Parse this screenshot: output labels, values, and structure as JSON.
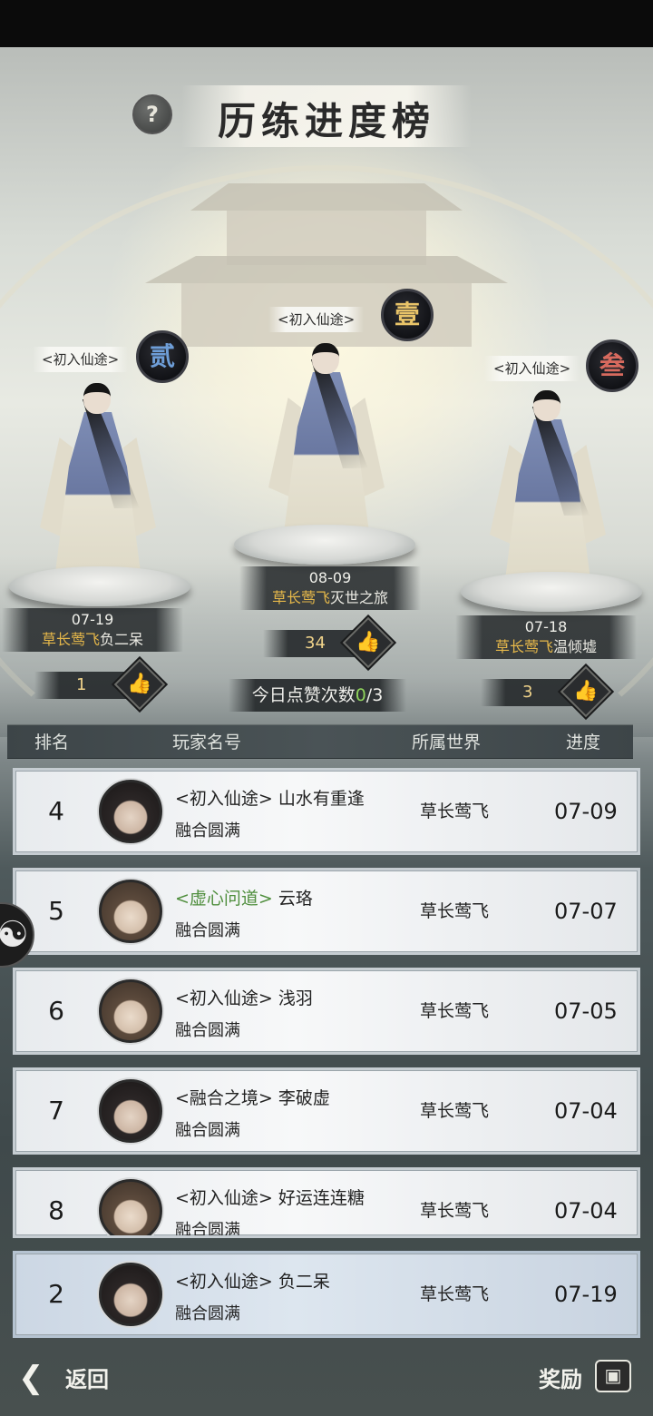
{
  "title": "历练进度榜",
  "help_icon": "?",
  "podium": {
    "first": {
      "realm_tag": "<初入仙途>",
      "seal": "壹",
      "date": "08-09",
      "world": "草长莺飞",
      "name": "灭世之旅",
      "likes": "34"
    },
    "second": {
      "realm_tag": "<初入仙途>",
      "seal": "贰",
      "date": "07-19",
      "world": "草长莺飞",
      "name": "负二呆",
      "likes": "1"
    },
    "third": {
      "realm_tag": "<初入仙途>",
      "seal": "叁",
      "date": "07-18",
      "world": "草长莺飞",
      "name": "温倾墟",
      "likes": "3"
    }
  },
  "likes_today": {
    "label": "今日点赞次数",
    "used": "0",
    "total": "/3"
  },
  "table_header": {
    "rank": "排名",
    "player": "玩家名号",
    "world": "所属世界",
    "progress": "进度"
  },
  "rows": [
    {
      "rank": "4",
      "realm": "<初入仙途>",
      "name": "山水有重逢",
      "stage": "融合圆满",
      "world": "草长莺飞",
      "date": "07-09"
    },
    {
      "rank": "5",
      "realm": "<虚心问道>",
      "name": "云珞",
      "stage": "融合圆满",
      "world": "草长莺飞",
      "date": "07-07"
    },
    {
      "rank": "6",
      "realm": "<初入仙途>",
      "name": "浅羽",
      "stage": "融合圆满",
      "world": "草长莺飞",
      "date": "07-05"
    },
    {
      "rank": "7",
      "realm": "<融合之境>",
      "name": "李破虚",
      "stage": "融合圆满",
      "world": "草长莺飞",
      "date": "07-04"
    },
    {
      "rank": "8",
      "realm": "<初入仙途>",
      "name": "好运连连糖",
      "stage": "融合圆满",
      "world": "草长莺飞",
      "date": "07-04"
    }
  ],
  "my_row": {
    "rank": "2",
    "realm": "<初入仙途>",
    "name": "负二呆",
    "stage": "融合圆满",
    "world": "草长莺飞",
    "date": "07-19"
  },
  "footer": {
    "back_label": "返回",
    "reward_label": "奖励"
  },
  "icons": {
    "thumb": "thumbs-up-icon",
    "yinyang": "yin-yang-icon",
    "back": "back-arrow-icon",
    "chest": "treasure-chest-icon"
  },
  "colors": {
    "gold": "#e6b84a",
    "green": "#8fd35c",
    "realm_green": "#4f8e3d"
  }
}
